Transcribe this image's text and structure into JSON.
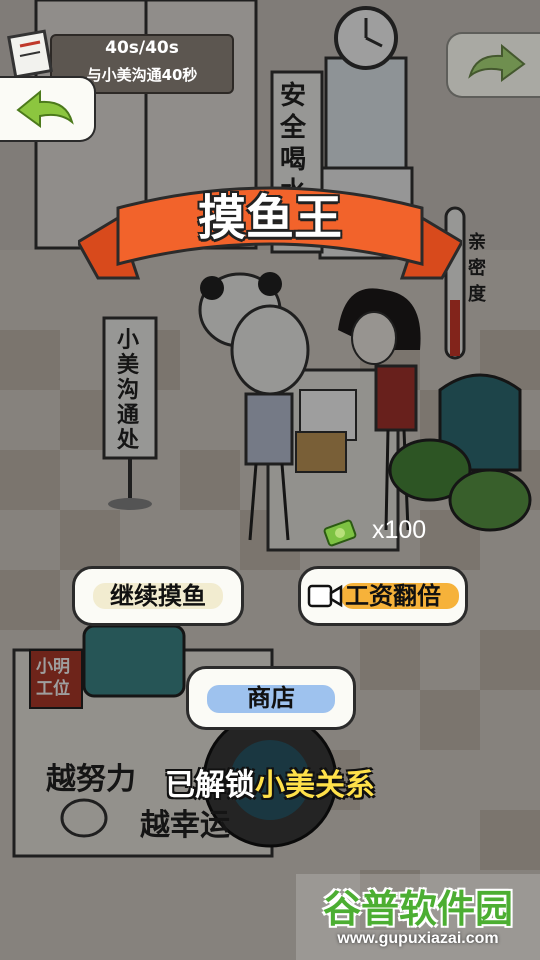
{
  "hud": {
    "timer": "40s/40s",
    "task": "与小美沟通40秒"
  },
  "scene": {
    "water_sign": "安全喝水",
    "affection_label": "亲密度",
    "communication_sign": "小美沟通处",
    "workstation_flag": "小明工位",
    "desk_slogan_1": "越努力",
    "desk_slogan_2": "越幸运"
  },
  "result": {
    "title": "摸鱼王",
    "reward_count": "x100",
    "continue_label": "继续摸鱼",
    "double_label": "工资翻倍",
    "shop_label": "商店",
    "unlock_prefix": "已解锁",
    "unlock_name": "小美关系"
  },
  "watermark": {
    "title": "谷普软件园",
    "url": "www.gupuxiazai.com"
  },
  "colors": {
    "ribbon": "#f2632b",
    "unlock_highlight": "#ffe14a",
    "watermark_green": "#4cae32",
    "continue_brush": "#f2ecd0",
    "double_brush": "#f6b23a",
    "shop_brush": "#9ec2ee"
  }
}
